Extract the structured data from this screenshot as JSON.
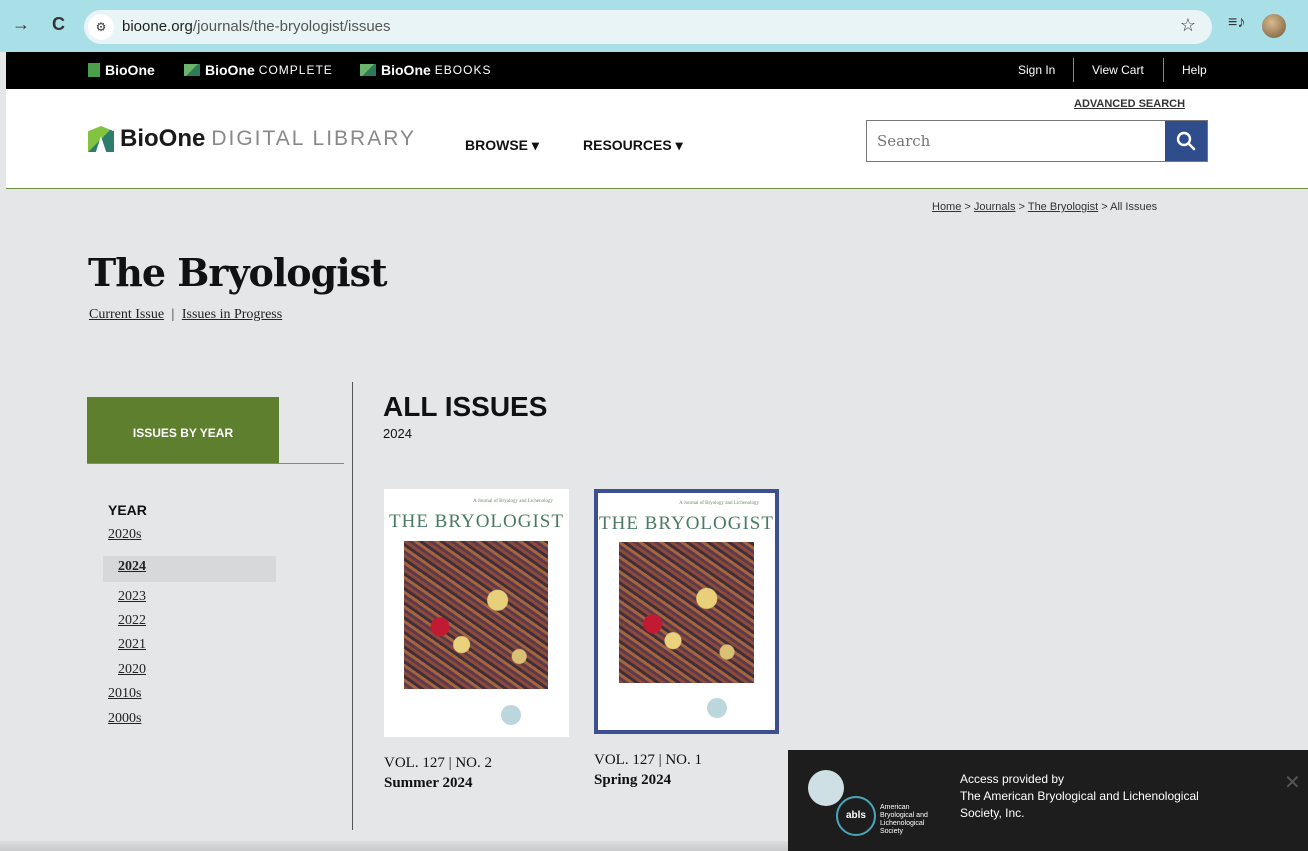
{
  "browser": {
    "back_icon": "→",
    "reload_icon": "C",
    "url_host": "bioone.org",
    "url_path": "/journals/the-bryologist/issues",
    "star_icon": "☆",
    "ext_icon": "≡♪"
  },
  "topbar": {
    "brand1": "BioOne",
    "brand2_bold": "BioOne",
    "brand2_light": "COMPLETE",
    "brand3_bold": "BioOne",
    "brand3_light": "EBOOKS",
    "sign_in": "Sign In",
    "view_cart": "View Cart",
    "help": "Help"
  },
  "header": {
    "logo_bold": "BioOne",
    "logo_light": "DIGITAL LIBRARY",
    "browse": "BROWSE ▾",
    "resources": "RESOURCES ▾",
    "advanced_search": "ADVANCED SEARCH",
    "search_placeholder": "Search"
  },
  "breadcrumb": {
    "home": "Home",
    "journals": "Journals",
    "journal": "The Bryologist",
    "current": "All Issues",
    "sep": ">"
  },
  "journal": {
    "title": "The Bryologist",
    "current_issue": "Current Issue",
    "divider": "|",
    "issues_in_progress": "Issues in Progress"
  },
  "sidebar": {
    "issues_by_year": "ISSUES BY YEAR",
    "year_heading": "YEAR",
    "decade_2020s": "2020s",
    "years": [
      "2024",
      "2023",
      "2022",
      "2021",
      "2020"
    ],
    "decade_2010s": "2010s",
    "decade_2000s": "2000s"
  },
  "main": {
    "heading": "ALL ISSUES",
    "year": "2024",
    "issues": [
      {
        "vol": "VOL. 127 | NO. 2",
        "season": "Summer 2024",
        "cover_title": "THE BRYOLOGIST",
        "cover_sub": "A Journal of Bryology and Lichenology"
      },
      {
        "vol": "VOL. 127 | NO. 1",
        "season": "Spring 2024",
        "cover_title": "THE BRYOLOGIST",
        "cover_sub": "A Journal of Bryology and Lichenology"
      }
    ]
  },
  "access": {
    "line1": "Access provided by",
    "line2": "The American Bryological and Lichenological",
    "line3": "Society, Inc.",
    "logo_text": "abls",
    "org_text": "American Bryological and Lichenological Society",
    "close": "✕"
  },
  "colors": {
    "accent_green": "#5e7f2d",
    "search_button": "#2f4d8a",
    "chrome_bar": "#a9e0e8",
    "selected_cover_border": "#3c4f8f"
  }
}
